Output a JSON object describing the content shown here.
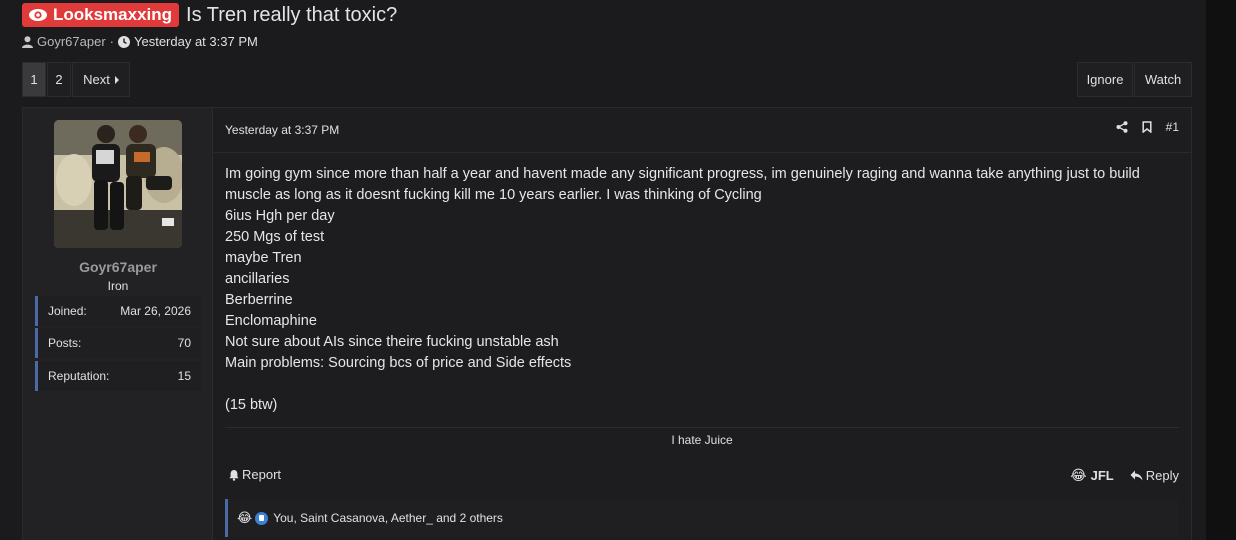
{
  "thread": {
    "prefix": "Looksmaxxing",
    "title": "Is Tren really that toxic?",
    "author": "Goyr67aper",
    "separator": "·",
    "date": "Yesterday at 3:37 PM"
  },
  "pagination": {
    "current": "1",
    "page2": "2",
    "next_label": "Next"
  },
  "thread_actions": {
    "ignore_label": "Ignore",
    "watch_label": "Watch"
  },
  "post": {
    "user": {
      "name": "Goyr67aper",
      "title": "Iron",
      "stats": [
        {
          "key": "Joined:",
          "value": "Mar 26, 2026"
        },
        {
          "key": "Posts:",
          "value": "70"
        },
        {
          "key": "Reputation:",
          "value": "15"
        }
      ]
    },
    "date": "Yesterday at 3:37 PM",
    "number": "#1",
    "body_lines": [
      "Im going gym since more than half a year and havent made any significant progress, im genuinely raging and wanna take anything just to build",
      "muscle as long as it doesnt fucking kill me 10 years earlier. I was thinking of Cycling",
      "6ius Hgh per day",
      "250 Mgs of test",
      "maybe Tren",
      "ancillaries",
      "Berberrine",
      "Enclomaphine",
      "Not sure about AIs since theire fucking unstable ash",
      "Main problems: Sourcing bcs of price and Side effects",
      "",
      "(15 btw)"
    ],
    "signature": "I hate Juice",
    "report_label": "Report",
    "reaction_label": "JFL",
    "reaction_emoji": "😂",
    "reply_label": "Reply",
    "reactions_summary": {
      "emoji": "😂",
      "text": "You, Saint Casanova, Aether_ and 2 others"
    }
  },
  "colors": {
    "prefix_bg": "#e03a3a",
    "accent_border": "#4a6aa8",
    "like_blue": "#3b82d6"
  }
}
